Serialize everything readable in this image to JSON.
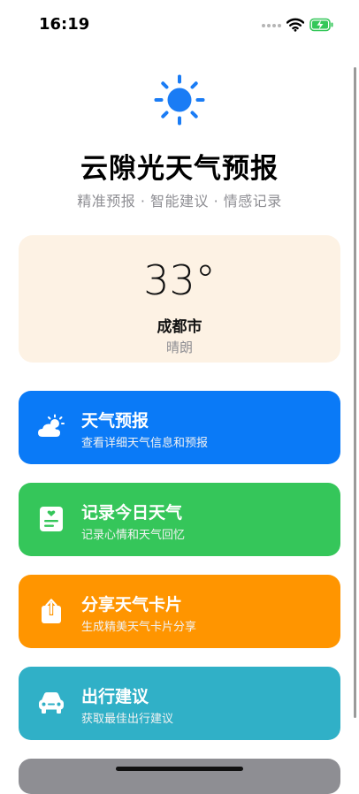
{
  "status": {
    "time": "16:19"
  },
  "header": {
    "title": "云隙光天气预报",
    "subtitle": "精准预报 · 智能建议 · 情感记录",
    "icon": "sun-icon",
    "accent": "#1a7cf5"
  },
  "weather": {
    "temperature": "33°",
    "city": "成都市",
    "condition": "晴朗",
    "background": "#fdf2e4"
  },
  "actions": [
    {
      "label": "天气预报",
      "subtitle": "查看详细天气信息和预报",
      "icon": "cloud-sun-icon",
      "color": "#0a7af7"
    },
    {
      "label": "记录今日天气",
      "subtitle": "记录心情和天气回忆",
      "icon": "journal-icon",
      "color": "#35c65a"
    },
    {
      "label": "分享天气卡片",
      "subtitle": "生成精美天气卡片分享",
      "icon": "share-icon",
      "color": "#ff9500"
    },
    {
      "label": "出行建议",
      "subtitle": "获取最佳出行建议",
      "icon": "car-icon",
      "color": "#30b0c7"
    }
  ]
}
